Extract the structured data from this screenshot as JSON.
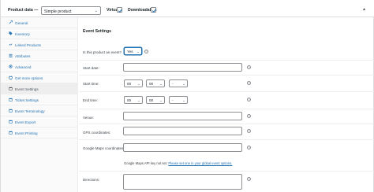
{
  "header": {
    "title": "Product data —",
    "product_type": "Simple product",
    "virtual_label": "Virtual:",
    "downloadable_label": "Downloadable:"
  },
  "sidebar": {
    "items": [
      {
        "label": "General",
        "icon": "wrench-icon"
      },
      {
        "label": "Inventory",
        "icon": "tag-icon"
      },
      {
        "label": "Linked Products",
        "icon": "link-icon"
      },
      {
        "label": "Attributes",
        "icon": "list-icon"
      },
      {
        "label": "Advanced",
        "icon": "gear-icon"
      },
      {
        "label": "Get more options",
        "icon": "plugin-icon"
      },
      {
        "label": "Event Settings",
        "icon": "calendar-icon"
      },
      {
        "label": "Ticket Settings",
        "icon": "calendar-icon"
      },
      {
        "label": "Event Terminology",
        "icon": "calendar-icon"
      },
      {
        "label": "Event Export",
        "icon": "calendar-icon"
      },
      {
        "label": "Event Printing",
        "icon": "calendar-icon"
      }
    ]
  },
  "content": {
    "section_title": "Event Settings",
    "is_event_label": "Is this product an event?",
    "is_event_value": "Yes",
    "start_date_label": "Start date:",
    "start_time_label": "Start time:",
    "end_time_label": "End time:",
    "hour_value": "00",
    "minute_value": "00",
    "ampm_value": "-",
    "venue_label": "Venue:",
    "gps_label": "GPS coordinates:",
    "maps_label": "Google Maps coordinates:",
    "maps_note": "Google Maps API key not set.",
    "maps_link": "Please set one in your global event options.",
    "directions_label": "Directions:",
    "help_glyph": "?",
    "chevron_glyph": "⌄"
  }
}
